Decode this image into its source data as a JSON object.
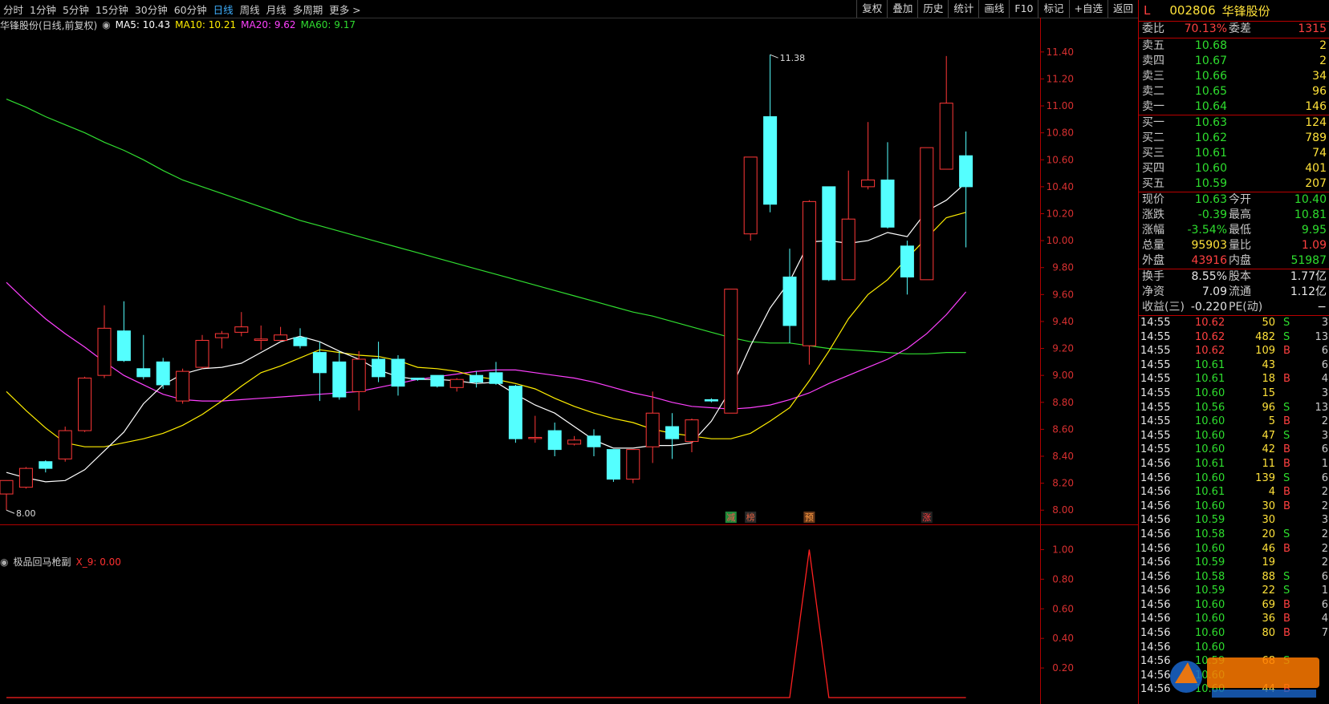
{
  "toolbar": {
    "periods": [
      "分时",
      "1分钟",
      "5分钟",
      "15分钟",
      "30分钟",
      "60分钟",
      "日线",
      "周线",
      "月线",
      "多周期",
      "更多 >"
    ],
    "active_period": "日线",
    "tools": [
      "复权",
      "叠加",
      "历史",
      "统计",
      "画线",
      "F10",
      "标记",
      "+自选",
      "返回"
    ]
  },
  "chart_header": {
    "name": "华锋股份(日线,前复权)",
    "ma5": "MA5: 10.43",
    "ma10": "MA10: 10.21",
    "ma20": "MA20: 9.62",
    "ma60": "MA60: 9.17",
    "colors": {
      "ma5": "#ffffff",
      "ma10": "#ffee00",
      "ma20": "#ff40ff",
      "ma60": "#30dd30"
    }
  },
  "sub_header": {
    "name": "极品回马枪副",
    "value": "X_9: 0.00"
  },
  "markers": [
    "减",
    "榜",
    "预",
    "涨"
  ],
  "price_axis": [
    "11.40",
    "11.20",
    "11.00",
    "10.80",
    "10.60",
    "10.40",
    "10.20",
    "10.00",
    "9.80",
    "9.60",
    "9.40",
    "9.20",
    "9.00",
    "8.80",
    "8.60",
    "8.40",
    "8.20",
    "8.00"
  ],
  "sub_axis": [
    "1.00",
    "0.80",
    "0.60",
    "0.40",
    "0.20"
  ],
  "high_label": "11.38",
  "low_label": "8.00",
  "chart_data": {
    "type": "candlestick",
    "ylim": [
      7.93,
      11.5
    ],
    "candles": [
      {
        "o": 8.12,
        "h": 8.21,
        "l": 8.0,
        "c": 8.22
      },
      {
        "o": 8.17,
        "h": 8.32,
        "l": 8.16,
        "c": 8.31
      },
      {
        "o": 8.36,
        "h": 8.37,
        "l": 8.28,
        "c": 8.31
      },
      {
        "o": 8.38,
        "h": 8.62,
        "l": 8.36,
        "c": 8.59
      },
      {
        "o": 8.59,
        "h": 8.99,
        "l": 8.58,
        "c": 8.98
      },
      {
        "o": 9.0,
        "h": 9.52,
        "l": 8.98,
        "c": 9.35
      },
      {
        "o": 9.33,
        "h": 9.55,
        "l": 9.1,
        "c": 9.11
      },
      {
        "o": 9.05,
        "h": 9.3,
        "l": 8.97,
        "c": 8.99
      },
      {
        "o": 9.1,
        "h": 9.13,
        "l": 8.9,
        "c": 8.93
      },
      {
        "o": 8.81,
        "h": 9.05,
        "l": 8.79,
        "c": 9.03
      },
      {
        "o": 9.06,
        "h": 9.3,
        "l": 9.05,
        "c": 9.26
      },
      {
        "o": 9.28,
        "h": 9.33,
        "l": 9.2,
        "c": 9.31
      },
      {
        "o": 9.32,
        "h": 9.47,
        "l": 9.29,
        "c": 9.36
      },
      {
        "o": 9.26,
        "h": 9.37,
        "l": 9.19,
        "c": 9.27
      },
      {
        "o": 9.26,
        "h": 9.36,
        "l": 9.26,
        "c": 9.3
      },
      {
        "o": 9.28,
        "h": 9.35,
        "l": 9.2,
        "c": 9.22
      },
      {
        "o": 9.17,
        "h": 9.25,
        "l": 8.81,
        "c": 9.02
      },
      {
        "o": 9.1,
        "h": 9.18,
        "l": 8.82,
        "c": 8.84
      },
      {
        "o": 8.88,
        "h": 9.18,
        "l": 8.74,
        "c": 9.12
      },
      {
        "o": 9.12,
        "h": 9.25,
        "l": 8.95,
        "c": 8.99
      },
      {
        "o": 9.12,
        "h": 9.15,
        "l": 8.85,
        "c": 8.92
      },
      {
        "o": 8.98,
        "h": 8.98,
        "l": 8.96,
        "c": 8.97
      },
      {
        "o": 9.0,
        "h": 9.0,
        "l": 8.91,
        "c": 8.92
      },
      {
        "o": 8.91,
        "h": 8.98,
        "l": 8.88,
        "c": 8.97
      },
      {
        "o": 9.0,
        "h": 9.03,
        "l": 8.91,
        "c": 8.95
      },
      {
        "o": 9.02,
        "h": 9.1,
        "l": 8.93,
        "c": 8.94
      },
      {
        "o": 8.92,
        "h": 8.93,
        "l": 8.5,
        "c": 8.53
      },
      {
        "o": 8.54,
        "h": 8.7,
        "l": 8.5,
        "c": 8.54
      },
      {
        "o": 8.59,
        "h": 8.65,
        "l": 8.4,
        "c": 8.45
      },
      {
        "o": 8.49,
        "h": 8.55,
        "l": 8.48,
        "c": 8.52
      },
      {
        "o": 8.55,
        "h": 8.6,
        "l": 8.4,
        "c": 8.47
      },
      {
        "o": 8.45,
        "h": 8.45,
        "l": 8.21,
        "c": 8.23
      },
      {
        "o": 8.23,
        "h": 8.45,
        "l": 8.2,
        "c": 8.45
      },
      {
        "o": 8.47,
        "h": 8.88,
        "l": 8.35,
        "c": 8.72
      },
      {
        "o": 8.62,
        "h": 8.72,
        "l": 8.38,
        "c": 8.53
      },
      {
        "o": 8.51,
        "h": 8.68,
        "l": 8.43,
        "c": 8.67
      },
      {
        "o": 8.82,
        "h": 8.83,
        "l": 8.8,
        "c": 8.81
      },
      {
        "o": 8.72,
        "h": 9.64,
        "l": 8.72,
        "c": 9.64
      },
      {
        "o": 10.05,
        "h": 10.62,
        "l": 10.0,
        "c": 10.62
      },
      {
        "o": 10.92,
        "h": 11.38,
        "l": 10.21,
        "c": 10.27
      },
      {
        "o": 9.73,
        "h": 9.94,
        "l": 9.24,
        "c": 9.37
      },
      {
        "o": 9.22,
        "h": 10.3,
        "l": 9.08,
        "c": 10.29
      },
      {
        "o": 10.4,
        "h": 10.4,
        "l": 9.7,
        "c": 9.71
      },
      {
        "o": 9.71,
        "h": 10.52,
        "l": 9.71,
        "c": 10.16
      },
      {
        "o": 10.4,
        "h": 10.88,
        "l": 10.38,
        "c": 10.45
      },
      {
        "o": 10.45,
        "h": 10.73,
        "l": 10.09,
        "c": 10.1
      },
      {
        "o": 9.96,
        "h": 10.0,
        "l": 9.6,
        "c": 9.73
      },
      {
        "o": 9.71,
        "h": 10.69,
        "l": 9.71,
        "c": 10.69
      },
      {
        "o": 10.53,
        "h": 11.37,
        "l": 10.53,
        "c": 11.02
      },
      {
        "o": 10.63,
        "h": 10.81,
        "l": 9.95,
        "c": 10.4
      }
    ],
    "ma5": [
      8.28,
      8.24,
      8.21,
      8.22,
      8.3,
      8.44,
      8.58,
      8.79,
      8.93,
      9.01,
      9.05,
      9.06,
      9.09,
      9.17,
      9.25,
      9.29,
      9.25,
      9.18,
      9.12,
      9.04,
      8.99,
      8.97,
      8.97,
      8.96,
      8.94,
      8.95,
      8.86,
      8.78,
      8.72,
      8.62,
      8.52,
      8.46,
      8.46,
      8.48,
      8.48,
      8.5,
      8.66,
      8.9,
      9.22,
      9.5,
      9.7,
      9.99,
      10.0,
      9.98,
      10.0,
      10.06,
      10.03,
      10.22,
      10.3,
      10.43
    ],
    "ma10": [
      8.88,
      8.74,
      8.61,
      8.5,
      8.47,
      8.47,
      8.5,
      8.53,
      8.57,
      8.63,
      8.71,
      8.81,
      8.92,
      9.02,
      9.07,
      9.13,
      9.19,
      9.17,
      9.15,
      9.14,
      9.11,
      9.06,
      9.05,
      9.03,
      8.99,
      8.97,
      8.94,
      8.9,
      8.83,
      8.77,
      8.72,
      8.68,
      8.65,
      8.6,
      8.57,
      8.55,
      8.53,
      8.53,
      8.57,
      8.66,
      8.76,
      8.96,
      9.18,
      9.42,
      9.6,
      9.71,
      9.87,
      10.02,
      10.17,
      10.21
    ],
    "ma20": [
      9.69,
      9.55,
      9.42,
      9.31,
      9.21,
      9.1,
      9.0,
      8.93,
      8.86,
      8.82,
      8.81,
      8.81,
      8.82,
      8.83,
      8.84,
      8.85,
      8.86,
      8.87,
      8.88,
      8.91,
      8.94,
      8.97,
      8.99,
      9.01,
      9.03,
      9.04,
      9.04,
      9.02,
      9.0,
      8.98,
      8.95,
      8.91,
      8.87,
      8.84,
      8.8,
      8.77,
      8.76,
      8.75,
      8.76,
      8.78,
      8.82,
      8.87,
      8.94,
      9.0,
      9.06,
      9.12,
      9.2,
      9.31,
      9.45,
      9.62
    ],
    "ma60": [
      11.05,
      10.99,
      10.92,
      10.86,
      10.8,
      10.73,
      10.67,
      10.6,
      10.52,
      10.45,
      10.4,
      10.35,
      10.3,
      10.25,
      10.2,
      10.15,
      10.11,
      10.07,
      10.03,
      9.99,
      9.95,
      9.91,
      9.87,
      9.83,
      9.79,
      9.75,
      9.71,
      9.67,
      9.63,
      9.59,
      9.55,
      9.51,
      9.47,
      9.44,
      9.4,
      9.36,
      9.32,
      9.28,
      9.25,
      9.24,
      9.24,
      9.22,
      9.2,
      9.19,
      9.18,
      9.17,
      9.16,
      9.16,
      9.17,
      9.17
    ],
    "subchart": {
      "ylim": [
        0,
        1.1
      ],
      "values": [
        0,
        0,
        0,
        0,
        0,
        0,
        0,
        0,
        0,
        0,
        0,
        0,
        0,
        0,
        0,
        0,
        0,
        0,
        0,
        0,
        0,
        0,
        0,
        0,
        0,
        0,
        0,
        0,
        0,
        0,
        0,
        0,
        0,
        0,
        0,
        0,
        0,
        0,
        0,
        0,
        0,
        1,
        0,
        0,
        0,
        0,
        0,
        0,
        0,
        0
      ]
    }
  },
  "quote": {
    "title": {
      "flag": "L",
      "code": "002806",
      "name": "华锋股份"
    },
    "weibi": {
      "label": "委比",
      "value": "70.13%",
      "label2": "委差",
      "value2": "1315"
    },
    "asks": [
      {
        "label": "卖五",
        "price": "10.68",
        "vol": "2"
      },
      {
        "label": "卖四",
        "price": "10.67",
        "vol": "2"
      },
      {
        "label": "卖三",
        "price": "10.66",
        "vol": "34"
      },
      {
        "label": "卖二",
        "price": "10.65",
        "vol": "96"
      },
      {
        "label": "卖一",
        "price": "10.64",
        "vol": "146"
      }
    ],
    "bids": [
      {
        "label": "买一",
        "price": "10.63",
        "vol": "124"
      },
      {
        "label": "买二",
        "price": "10.62",
        "vol": "789"
      },
      {
        "label": "买三",
        "price": "10.61",
        "vol": "74"
      },
      {
        "label": "买四",
        "price": "10.60",
        "vol": "401"
      },
      {
        "label": "买五",
        "price": "10.59",
        "vol": "207"
      }
    ],
    "stats1": [
      {
        "l1": "现价",
        "v1": "10.63",
        "c1": "green",
        "l2": "今开",
        "v2": "10.40",
        "c2": "green"
      },
      {
        "l1": "涨跌",
        "v1": "-0.39",
        "c1": "green",
        "l2": "最高",
        "v2": "10.81",
        "c2": "green"
      },
      {
        "l1": "涨幅",
        "v1": "-3.54%",
        "c1": "green",
        "l2": "最低",
        "v2": "9.95",
        "c2": "green"
      },
      {
        "l1": "总量",
        "v1": "95903",
        "c1": "yellow",
        "l2": "量比",
        "v2": "1.09",
        "c2": "red"
      },
      {
        "l1": "外盘",
        "v1": "43916",
        "c1": "red",
        "l2": "内盘",
        "v2": "51987",
        "c2": "green"
      }
    ],
    "stats2": [
      {
        "l1": "换手",
        "v1": "8.55%",
        "l2": "股本",
        "v2": "1.77亿"
      },
      {
        "l1": "净资",
        "v1": "7.09",
        "l2": "流通",
        "v2": "1.12亿"
      },
      {
        "l1": "收益(三)",
        "v1": "-0.220",
        "l2": "PE(动)",
        "v2": "−"
      }
    ],
    "ticks": [
      {
        "time": "14:55",
        "price": "10.62",
        "vol": "50",
        "side": "S",
        "n": "3"
      },
      {
        "time": "14:55",
        "price": "10.62",
        "vol": "482",
        "side": "S",
        "n": "13"
      },
      {
        "time": "14:55",
        "price": "10.62",
        "vol": "109",
        "side": "B",
        "n": "6"
      },
      {
        "time": "14:55",
        "price": "10.61",
        "vol": "43",
        "side": "",
        "n": "6"
      },
      {
        "time": "14:55",
        "price": "10.61",
        "vol": "18",
        "side": "B",
        "n": "4"
      },
      {
        "time": "14:55",
        "price": "10.60",
        "vol": "15",
        "side": "",
        "n": "3"
      },
      {
        "time": "14:55",
        "price": "10.56",
        "vol": "96",
        "side": "S",
        "n": "13"
      },
      {
        "time": "14:55",
        "price": "10.60",
        "vol": "5",
        "side": "B",
        "n": "2"
      },
      {
        "time": "14:55",
        "price": "10.60",
        "vol": "47",
        "side": "S",
        "n": "3"
      },
      {
        "time": "14:55",
        "price": "10.60",
        "vol": "42",
        "side": "B",
        "n": "6"
      },
      {
        "time": "14:56",
        "price": "10.61",
        "vol": "11",
        "side": "B",
        "n": "1"
      },
      {
        "time": "14:56",
        "price": "10.60",
        "vol": "139",
        "side": "S",
        "n": "6"
      },
      {
        "time": "14:56",
        "price": "10.61",
        "vol": "4",
        "side": "B",
        "n": "2"
      },
      {
        "time": "14:56",
        "price": "10.60",
        "vol": "30",
        "side": "B",
        "n": "2"
      },
      {
        "time": "14:56",
        "price": "10.59",
        "vol": "30",
        "side": "",
        "n": "3"
      },
      {
        "time": "14:56",
        "price": "10.58",
        "vol": "20",
        "side": "S",
        "n": "2"
      },
      {
        "time": "14:56",
        "price": "10.60",
        "vol": "46",
        "side": "B",
        "n": "2"
      },
      {
        "time": "14:56",
        "price": "10.59",
        "vol": "19",
        "side": "",
        "n": "2"
      },
      {
        "time": "14:56",
        "price": "10.58",
        "vol": "88",
        "side": "S",
        "n": "6"
      },
      {
        "time": "14:56",
        "price": "10.59",
        "vol": "22",
        "side": "S",
        "n": "1"
      },
      {
        "time": "14:56",
        "price": "10.60",
        "vol": "69",
        "side": "B",
        "n": "6"
      },
      {
        "time": "14:56",
        "price": "10.60",
        "vol": "36",
        "side": "B",
        "n": "4"
      },
      {
        "time": "14:56",
        "price": "10.60",
        "vol": "80",
        "side": "B",
        "n": "7"
      },
      {
        "time": "14:56",
        "price": "10.60",
        "vol": "",
        "side": "",
        "n": ""
      },
      {
        "time": "14:56",
        "price": "10.59",
        "vol": "68",
        "side": "S",
        "n": ""
      },
      {
        "time": "14:56",
        "price": "10.60",
        "vol": "",
        "side": "",
        "n": ""
      },
      {
        "time": "14:56",
        "price": "10.60",
        "vol": "44",
        "side": "B",
        "n": ""
      }
    ]
  }
}
